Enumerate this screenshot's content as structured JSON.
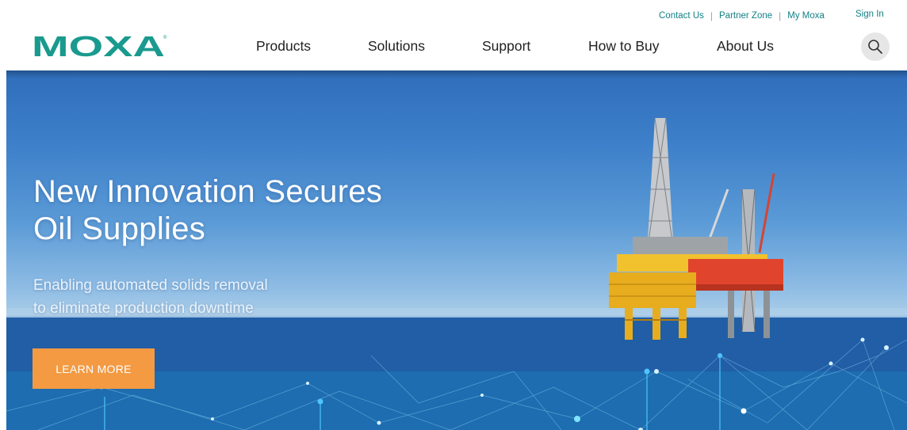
{
  "utility_nav": {
    "items": [
      "Contact Us",
      "Partner Zone",
      "My Moxa"
    ],
    "sign_in": "Sign In"
  },
  "brand": {
    "name": "MOXA",
    "registered_mark": "®",
    "color": "#1a9a8e"
  },
  "main_nav": {
    "items": [
      "Products",
      "Solutions",
      "Support",
      "How to Buy",
      "About Us"
    ]
  },
  "search": {
    "icon": "search-icon"
  },
  "hero": {
    "title_line1": "New Innovation Secures",
    "title_line2": "Oil Supplies",
    "subtitle_line1": "Enabling automated solids removal",
    "subtitle_line2": "to eliminate production downtime",
    "cta_label": "LEARN MORE",
    "cta_color": "#f39a42"
  },
  "colors": {
    "link": "#138085",
    "nav_text": "#222222"
  }
}
